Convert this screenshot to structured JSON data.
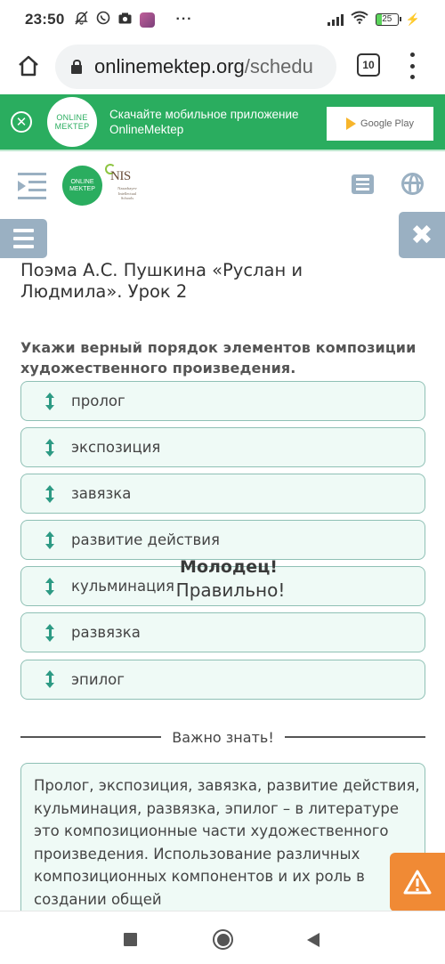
{
  "status_bar": {
    "time": "23:50",
    "battery_level": "25",
    "icons_left": [
      "notifications-muted-icon",
      "whatsapp-icon",
      "camera-icon",
      "app-icon",
      "more-dots-icon"
    ],
    "icons_right": [
      "signal-icon",
      "wifi-icon",
      "battery-icon",
      "charging-icon"
    ]
  },
  "browser": {
    "url_domain": "onlinemektep.org",
    "url_path": "/schedu",
    "tab_count": "10"
  },
  "banner": {
    "logo_line1": "ONLINE",
    "logo_line2": "MEKTEP",
    "text_line1": "Скачайте мобильное приложение",
    "text_line2": "OnlineMektep",
    "store_button": "Google Play",
    "color": "#2aad5f"
  },
  "header": {
    "logo_line1": "ONLINE",
    "logo_line2": "MEKTEP",
    "partner_logo": "NIS",
    "partner_sub": "Nazarbayev Intellectual Schools"
  },
  "lesson": {
    "title": "Поэма А.С. Пушкина «Руслан и Людмила». Урок 2"
  },
  "task": {
    "question": "Укажи верный порядок элементов композиции художественного произведения.",
    "items": [
      {
        "label": "пролог"
      },
      {
        "label": "экспозиция"
      },
      {
        "label": "завязка"
      },
      {
        "label": "развитие действия"
      },
      {
        "label": "кульминация"
      },
      {
        "label": "развязка"
      },
      {
        "label": "эпилог"
      }
    ],
    "feedback_title": "Молодец!",
    "feedback_sub": "Правильно!"
  },
  "info": {
    "heading": "Важно знать!",
    "text": "Пролог, экспозиция, завязка, развитие действия, кульминация, развязка, эпилог – в литературе это композиционные части художественного произведения. Использование различных композиционных компонентов и их роль в создании общей"
  },
  "colors": {
    "accent_green": "#2aad5f",
    "item_bg": "#effaf6",
    "item_border": "#8fc0b5",
    "drag_icon": "#2d9a84",
    "control_gray": "#9ab0c2",
    "warning": "#f08a35"
  }
}
